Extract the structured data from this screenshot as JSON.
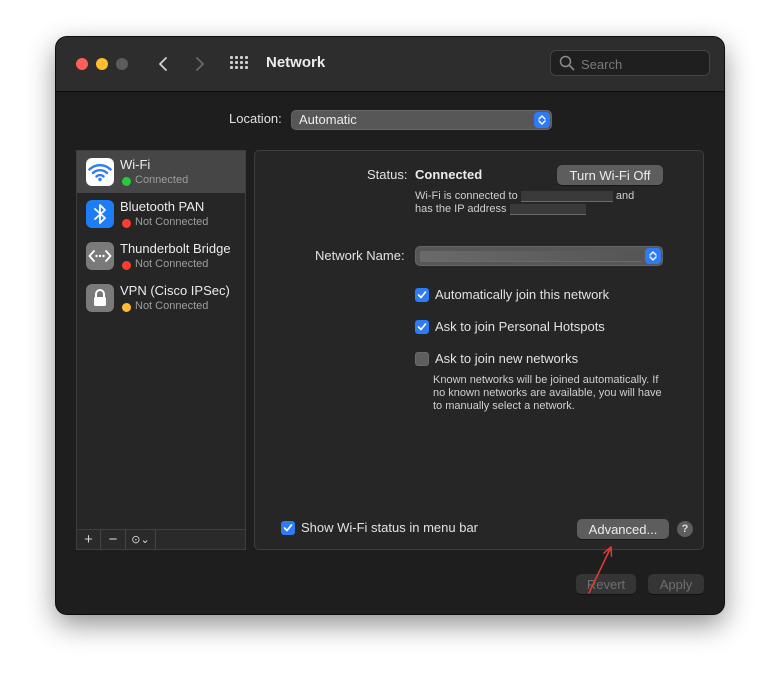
{
  "window": {
    "title": "Network"
  },
  "search": {
    "placeholder": "Search"
  },
  "location": {
    "label": "Location:",
    "value": "Automatic"
  },
  "services": [
    {
      "name": "Wi-Fi",
      "status": "Connected",
      "status_color": "#27c93f",
      "icon": "wifi-icon",
      "selected": true
    },
    {
      "name": "Bluetooth PAN",
      "status": "Not Connected",
      "status_color": "#ff3b30",
      "icon": "bluetooth-icon"
    },
    {
      "name": "Thunderbolt Bridge",
      "status": "Not Connected",
      "status_color": "#ff3b30",
      "icon": "thunderbolt-bridge-icon"
    },
    {
      "name": "VPN (Cisco IPSec)",
      "status": "Not Connected",
      "status_color": "#febc2e",
      "icon": "lock-icon"
    }
  ],
  "sidebar_toolbar": {
    "add": "+",
    "remove": "−",
    "action": "⊙⌄"
  },
  "detail": {
    "status_label": "Status:",
    "status_value": "Connected",
    "turn_off_button": "Turn Wi-Fi Off",
    "connected_line_prefix": "Wi-Fi is connected to",
    "connected_line_suffix": "and",
    "ip_line_prefix": "has the IP address",
    "network_name_label": "Network Name:",
    "auto_join": {
      "label": "Automatically join this network",
      "checked": true
    },
    "ask_hotspots": {
      "label": "Ask to join Personal Hotspots",
      "checked": true
    },
    "ask_new": {
      "label": "Ask to join new networks",
      "checked": false
    },
    "note_lines": [
      "Known networks will be joined automatically. If",
      "no known networks are available, you will have",
      "to manually select a network."
    ],
    "show_status": {
      "label": "Show Wi-Fi status in menu bar",
      "checked": true
    },
    "advanced_button": "Advanced...",
    "help": "?"
  },
  "footer": {
    "revert": "Revert",
    "apply": "Apply"
  },
  "colors": {
    "accent": "#2f7bf5",
    "annotation_arrow": "#e53935"
  }
}
